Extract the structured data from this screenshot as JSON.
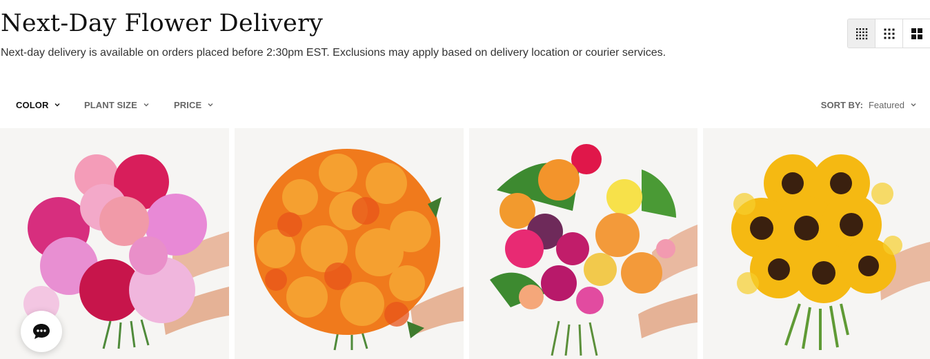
{
  "header": {
    "title": "Next-Day Flower Delivery",
    "subtitle": "Next-day delivery is available on orders placed before 2:30pm EST. Exclusions may apply based on delivery location or courier services."
  },
  "view_toggle": {
    "options": [
      {
        "icon": "grid-4x4-icon",
        "active": true
      },
      {
        "icon": "grid-3x3-icon",
        "active": false
      },
      {
        "icon": "grid-2x2-icon",
        "active": false
      }
    ]
  },
  "filters": {
    "items": [
      {
        "label": "COLOR",
        "icon": "chevron-down-icon"
      },
      {
        "label": "PLANT SIZE",
        "icon": "chevron-down-icon"
      },
      {
        "label": "PRICE",
        "icon": "chevron-down-icon"
      }
    ],
    "sort": {
      "label": "SORT BY:",
      "value": "Featured",
      "icon": "chevron-down-icon"
    }
  },
  "products": [
    {
      "image": "pink-peony-bouquet-image"
    },
    {
      "image": "orange-rose-bouquet-image"
    },
    {
      "image": "mixed-bright-bouquet-image"
    },
    {
      "image": "sunflower-bouquet-image"
    }
  ],
  "chat": {
    "icon": "chat-bubble-icon"
  },
  "colors": {
    "card_background": "#f6f5f3",
    "active_view_background": "#eeeeee",
    "filter_text": "#666666",
    "active_filter_text": "#111111"
  }
}
